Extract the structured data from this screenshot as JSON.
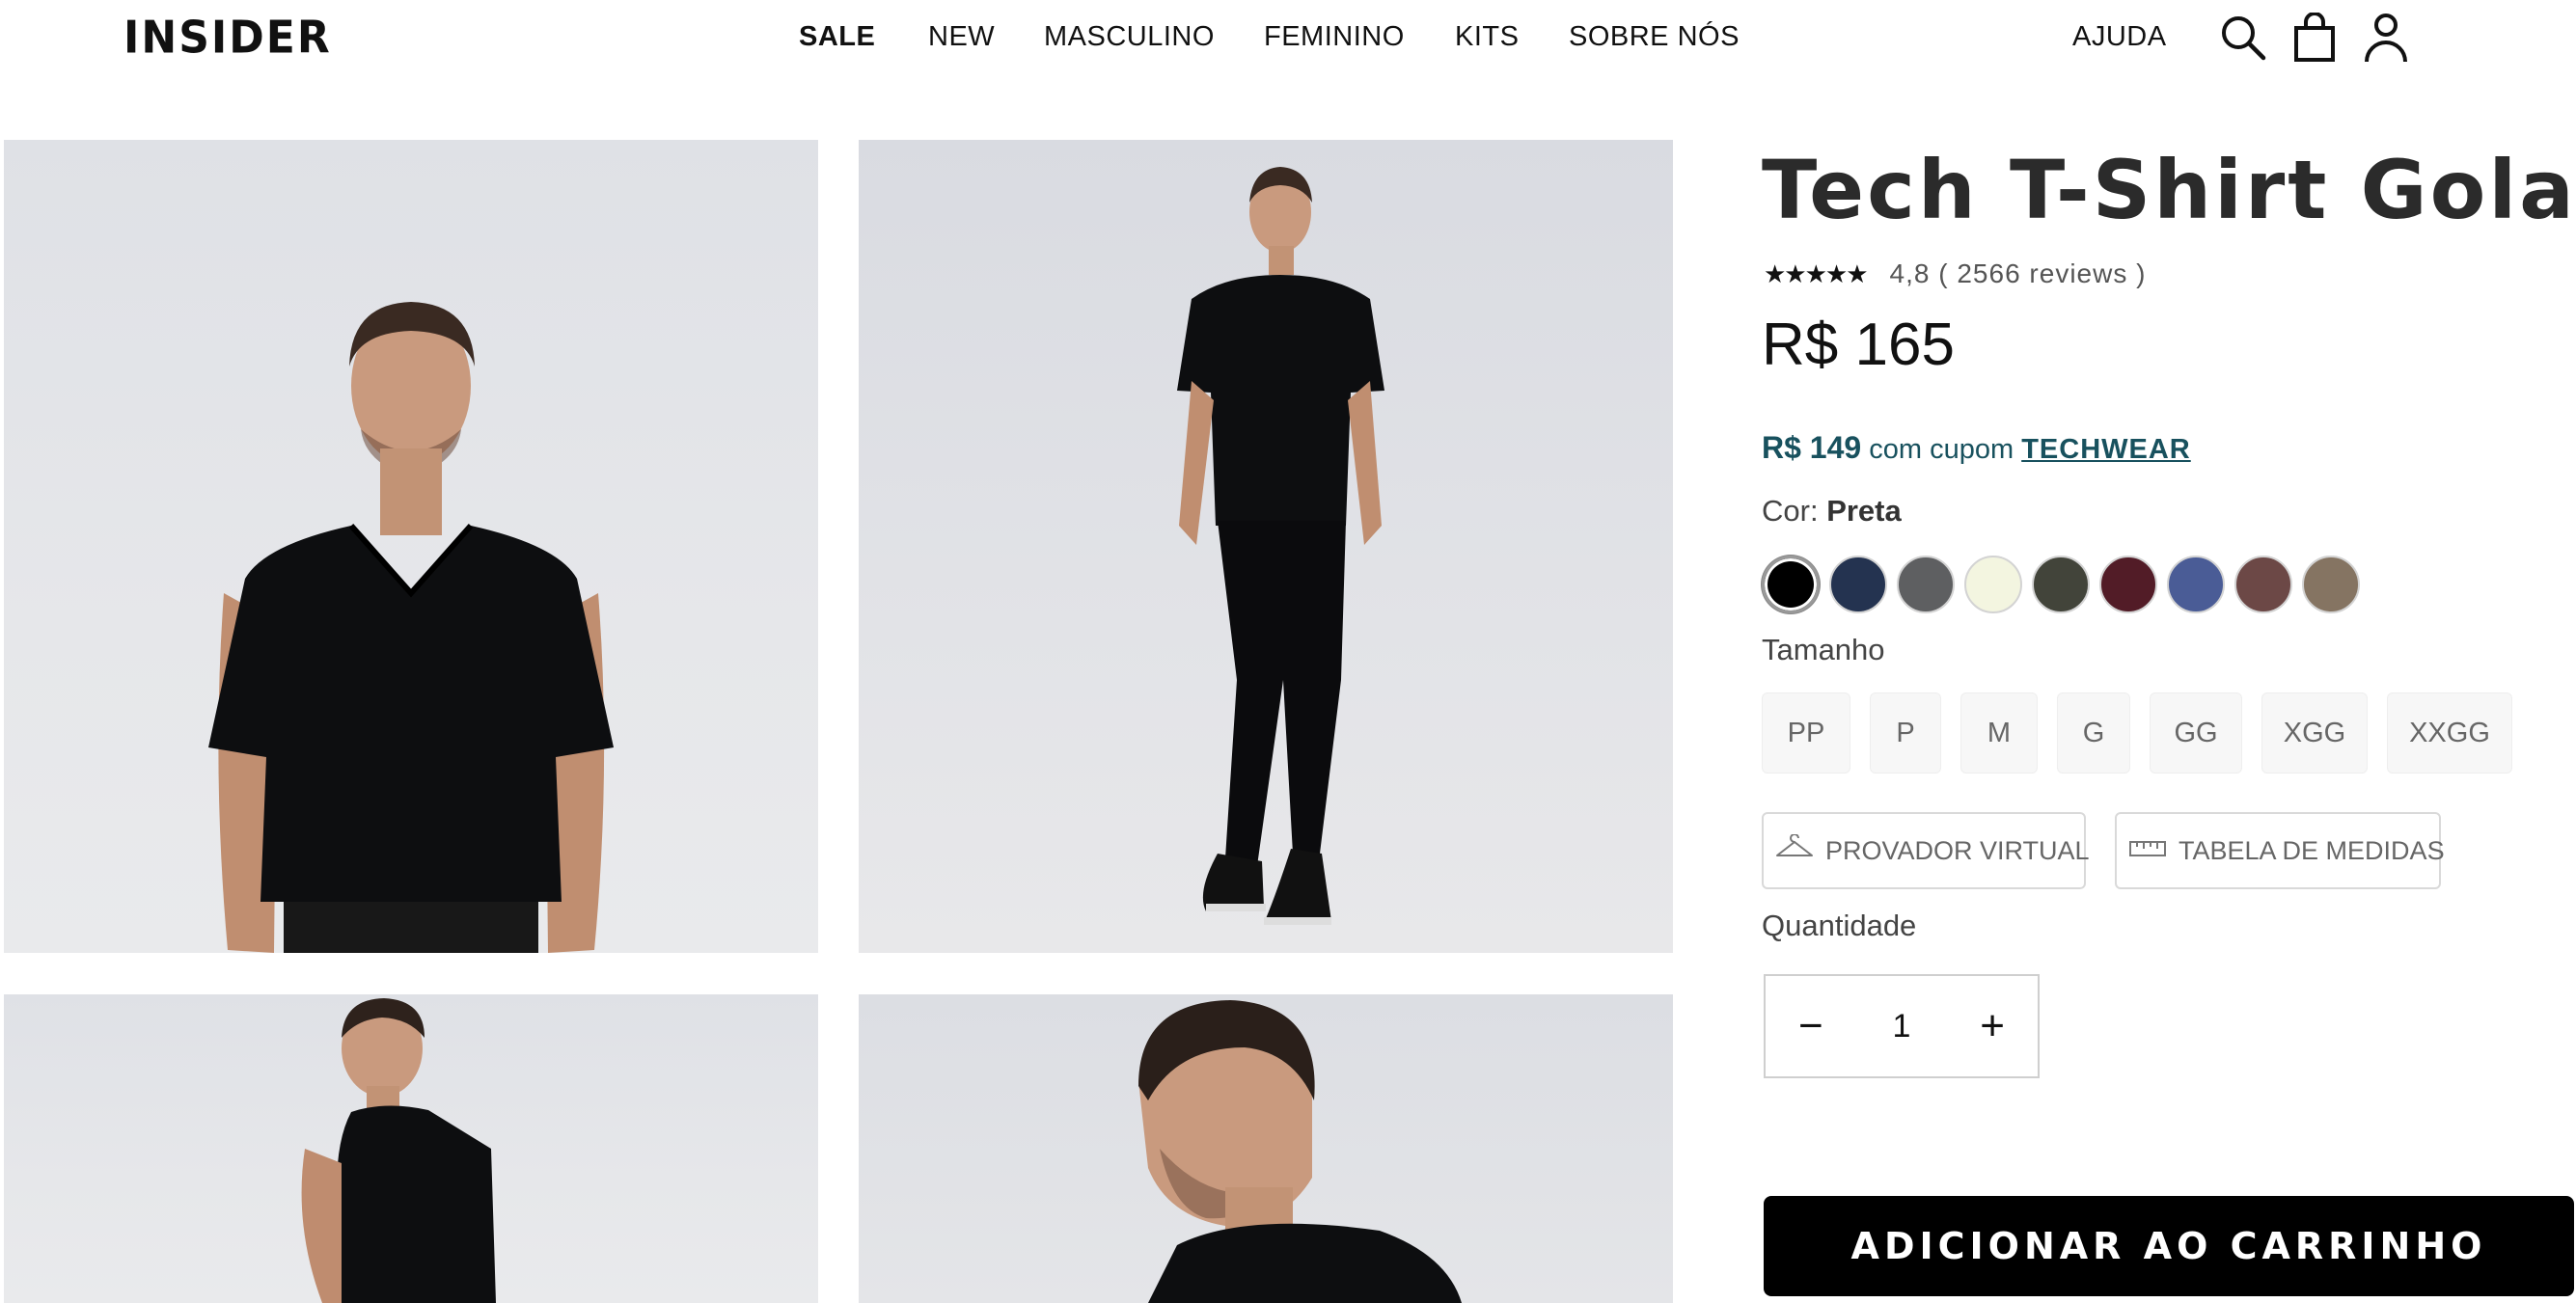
{
  "header": {
    "logo": "INSIDER",
    "nav": [
      "SALE",
      "NEW",
      "MASCULINO",
      "FEMININO",
      "KITS",
      "SOBRE NÓS"
    ],
    "help": "AJUDA",
    "icons": [
      "search-icon",
      "bag-icon",
      "user-icon"
    ]
  },
  "gallery": {
    "images": [
      "front-view",
      "full-body-view",
      "back-view",
      "profile-view"
    ]
  },
  "product": {
    "title": "Tech T-Shirt Gola V",
    "stars": "★★★★★",
    "rating_text": "4,8 ( 2566 reviews )",
    "price": "R$ 165",
    "coupon_price": "R$ 149",
    "coupon_text": " com cupom ",
    "coupon_code": "TECHWEAR",
    "color_label": "Cor: ",
    "color_selected": "Preta",
    "swatches": [
      "#000000",
      "#243350",
      "#5e5f61",
      "#f3f5e0",
      "#42443a",
      "#521c27",
      "#4a5c96",
      "#6c4846",
      "#857462"
    ],
    "size_label": "Tamanho",
    "sizes": [
      "PP",
      "P",
      "M",
      "G",
      "GG",
      "XGG",
      "XXGG"
    ],
    "virtual_fitting": "PROVADOR VIRTUAL",
    "size_chart": "TABELA DE MEDIDAS",
    "quantity_label": "Quantidade",
    "quantity": "1",
    "minus": "−",
    "plus": "+",
    "add_to_cart": "ADICIONAR AO CARRINHO"
  }
}
